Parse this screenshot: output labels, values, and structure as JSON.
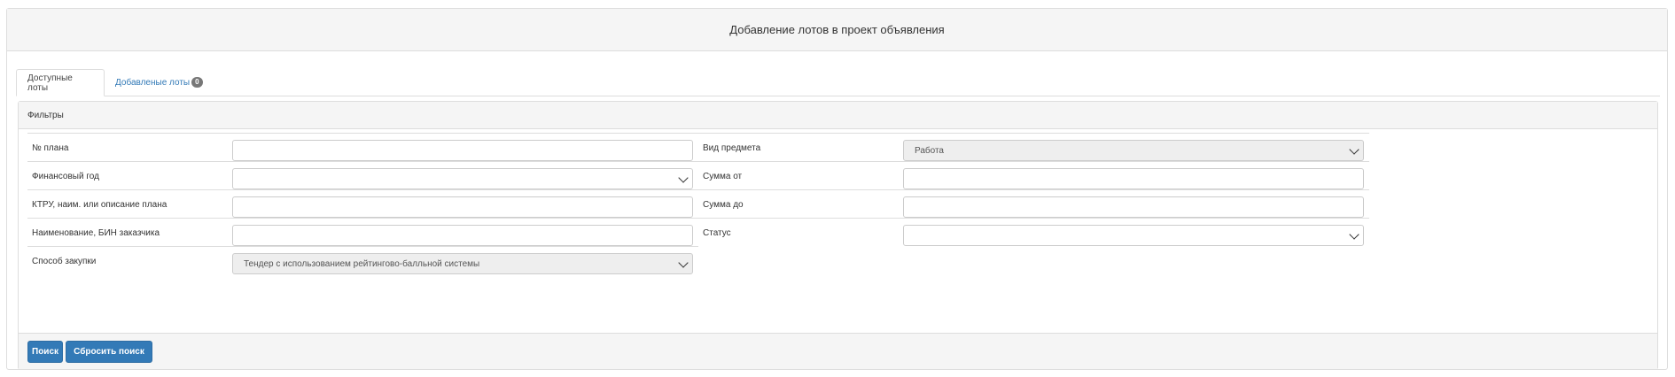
{
  "header": {
    "title": "Добавление лотов в проект объявления"
  },
  "tabs": [
    {
      "label": "Доступные лоты"
    },
    {
      "label": "Добавленые лоты",
      "badge": "0"
    }
  ],
  "filters": {
    "title": "Фильтры",
    "left": [
      {
        "label": "№ плана",
        "value": ""
      },
      {
        "label": "Финансовый год",
        "value": ""
      },
      {
        "label": "КТРУ, наим. или описание плана",
        "value": ""
      },
      {
        "label": "Наименование, БИН заказчика",
        "value": ""
      },
      {
        "label": "Способ закупки",
        "value": "Тендер с использованием рейтингово-балльной системы"
      }
    ],
    "right": [
      {
        "label": "Вид предмета",
        "value": "Работа"
      },
      {
        "label": "Сумма от",
        "value": ""
      },
      {
        "label": "Сумма до",
        "value": ""
      },
      {
        "label": "Статус",
        "value": ""
      }
    ]
  },
  "buttons": {
    "search": "Поиск",
    "reset": "Сбросить поиск"
  }
}
